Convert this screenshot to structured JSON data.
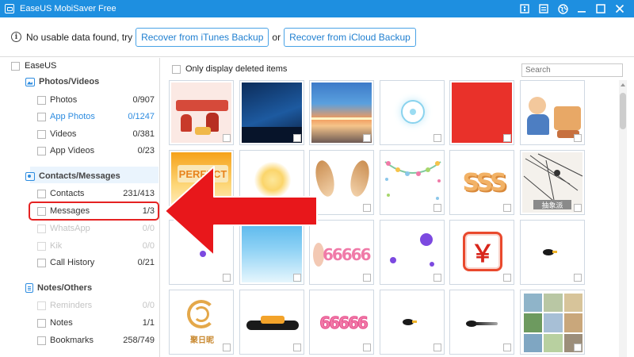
{
  "window": {
    "title": "EaseUS MobiSaver Free"
  },
  "notice": {
    "text": "No usable data found, try",
    "itunes_button": "Recover from iTunes Backup",
    "or_text": "or",
    "icloud_button": "Recover from iCloud Backup"
  },
  "sidebar": {
    "root_label": "EaseUS",
    "sections": [
      {
        "title": "Photos/Videos",
        "items": [
          {
            "label": "Photos",
            "count": "0/907"
          },
          {
            "label": "App Photos",
            "count": "0/1247"
          },
          {
            "label": "Videos",
            "count": "0/381"
          },
          {
            "label": "App Videos",
            "count": "0/23"
          }
        ]
      },
      {
        "title": "Contacts/Messages",
        "items": [
          {
            "label": "Contacts",
            "count": "231/413"
          },
          {
            "label": "Messages",
            "count": "1/3"
          },
          {
            "label": "WhatsApp",
            "count": "0/0"
          },
          {
            "label": "Kik",
            "count": "0/0"
          },
          {
            "label": "Call History",
            "count": "0/21"
          }
        ]
      },
      {
        "title": "Notes/Others",
        "items": [
          {
            "label": "Reminders",
            "count": "0/0"
          },
          {
            "label": "Notes",
            "count": "1/1"
          },
          {
            "label": "Bookmarks",
            "count": "258/749"
          }
        ]
      }
    ]
  },
  "main": {
    "only_deleted_label": "Only display deleted items",
    "search_placeholder": "Search",
    "thumbnails": [
      {
        "kind": "people-red"
      },
      {
        "kind": "night-sky"
      },
      {
        "kind": "sunset-sea"
      },
      {
        "kind": "light-burst"
      },
      {
        "kind": "red-square"
      },
      {
        "kind": "cartoon-family"
      },
      {
        "kind": "perfect-banner",
        "text": "PERFECT"
      },
      {
        "kind": "sun-glow"
      },
      {
        "kind": "cat-ears"
      },
      {
        "kind": "flower-garland"
      },
      {
        "kind": "sss-letters",
        "text": "SSS"
      },
      {
        "kind": "music-sketch",
        "text": "抽象派"
      },
      {
        "kind": "purple-dot-small"
      },
      {
        "kind": "blue-gradient"
      },
      {
        "kind": "pink-666-ear",
        "text": "66666"
      },
      {
        "kind": "purple-bubbles"
      },
      {
        "kind": "yen-button",
        "text": "￥"
      },
      {
        "kind": "bird-small"
      },
      {
        "kind": "gold-swirl",
        "text": "聚日昵"
      },
      {
        "kind": "bird-group"
      },
      {
        "kind": "pink-666",
        "text": "66666"
      },
      {
        "kind": "bird-small"
      },
      {
        "kind": "bird-trail"
      },
      {
        "kind": "photo-collage"
      }
    ]
  },
  "colors": {
    "titlebar": "#1e8fe0",
    "accent": "#2d8ce0",
    "highlight_red": "#e52222"
  }
}
